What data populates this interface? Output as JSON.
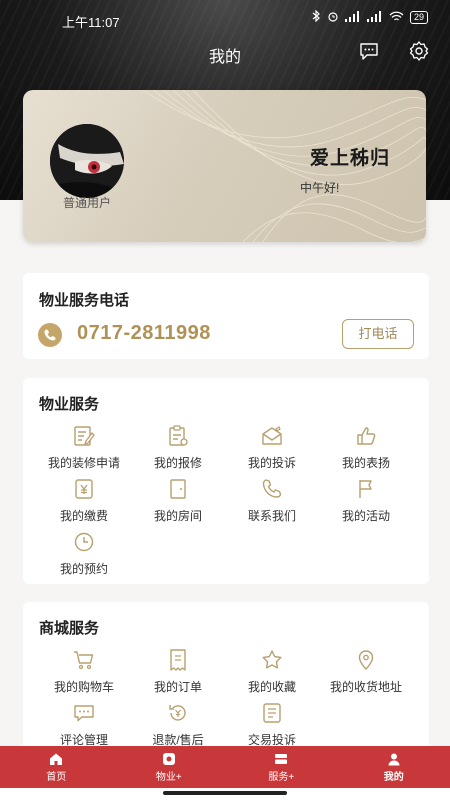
{
  "status_bar": {
    "time": "上午11:07",
    "battery": "29"
  },
  "header": {
    "title": "我的"
  },
  "profile": {
    "name": "爱上秭归",
    "greeting": "中午好!",
    "role": "普通用户"
  },
  "phone_section": {
    "title": "物业服务电话",
    "number": "0717-2811998",
    "call_label": "打电话"
  },
  "property_services": {
    "title": "物业服务",
    "items": [
      {
        "label": "我的装修申请",
        "icon": "renovation-icon"
      },
      {
        "label": "我的报修",
        "icon": "repair-icon"
      },
      {
        "label": "我的投诉",
        "icon": "complaint-icon"
      },
      {
        "label": "我的表扬",
        "icon": "thumbs-up-icon"
      },
      {
        "label": "我的缴费",
        "icon": "payment-icon"
      },
      {
        "label": "我的房间",
        "icon": "room-door-icon"
      },
      {
        "label": "联系我们",
        "icon": "phone-contact-icon"
      },
      {
        "label": "我的活动",
        "icon": "flag-icon"
      },
      {
        "label": "我的预约",
        "icon": "clock-icon"
      }
    ]
  },
  "mall_services": {
    "title": "商城服务",
    "items": [
      {
        "label": "我的购物车",
        "icon": "cart-icon"
      },
      {
        "label": "我的订单",
        "icon": "receipt-icon"
      },
      {
        "label": "我的收藏",
        "icon": "star-icon"
      },
      {
        "label": "我的收货地址",
        "icon": "location-pin-icon"
      },
      {
        "label": "评论管理",
        "icon": "comment-icon"
      },
      {
        "label": "退款/售后",
        "icon": "refund-icon"
      },
      {
        "label": "交易投诉",
        "icon": "trade-complaint-icon"
      }
    ]
  },
  "tabbar": {
    "tabs": [
      {
        "label": "首页",
        "icon": "home-icon"
      },
      {
        "label": "物业+",
        "icon": "property-icon"
      },
      {
        "label": "服务+",
        "icon": "service-icon"
      },
      {
        "label": "我的",
        "icon": "user-icon"
      }
    ],
    "active": "我的"
  },
  "colors": {
    "gold": "#b09156",
    "accent_red": "#c8383b",
    "dark_header": "#1b1b1b"
  }
}
